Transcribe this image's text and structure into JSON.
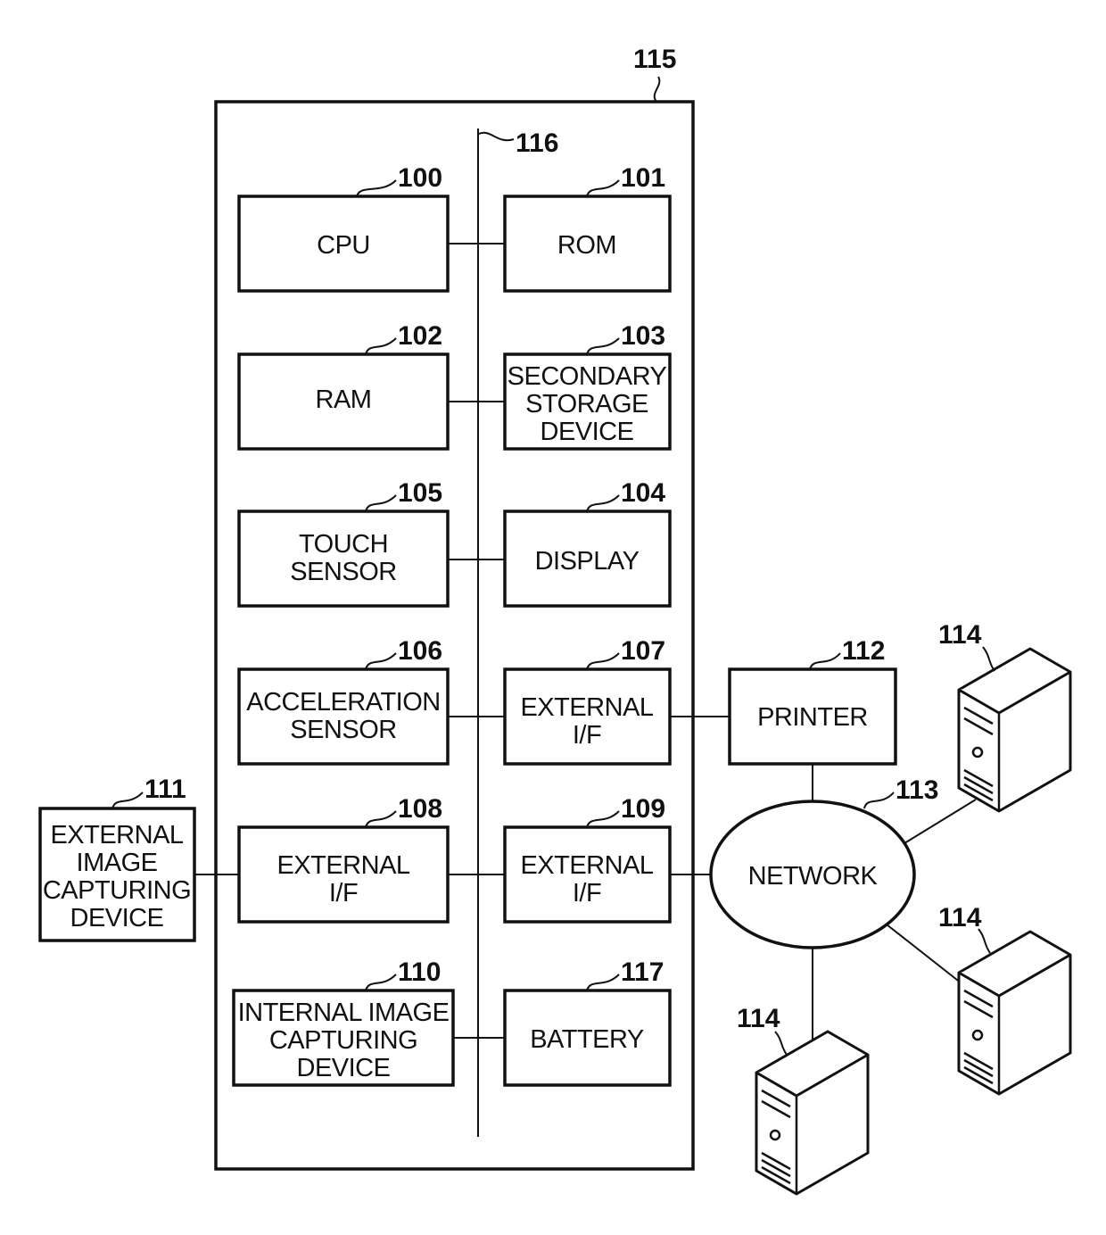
{
  "diagram": {
    "device": {
      "ref": "115"
    },
    "bus": {
      "ref": "116"
    },
    "components": {
      "cpu": {
        "ref": "100",
        "lines": [
          "CPU"
        ]
      },
      "rom": {
        "ref": "101",
        "lines": [
          "ROM"
        ]
      },
      "ram": {
        "ref": "102",
        "lines": [
          "RAM"
        ]
      },
      "secondary_storage": {
        "ref": "103",
        "lines": [
          "SECONDARY",
          "STORAGE",
          "DEVICE"
        ]
      },
      "touch_sensor": {
        "ref": "105",
        "lines": [
          "TOUCH",
          "SENSOR"
        ]
      },
      "display": {
        "ref": "104",
        "lines": [
          "DISPLAY"
        ]
      },
      "acceleration_sensor": {
        "ref": "106",
        "lines": [
          "ACCELERATION",
          "SENSOR"
        ]
      },
      "external_if_107": {
        "ref": "107",
        "lines": [
          "EXTERNAL",
          "I/F"
        ]
      },
      "external_if_108": {
        "ref": "108",
        "lines": [
          "EXTERNAL",
          "I/F"
        ]
      },
      "external_if_109": {
        "ref": "109",
        "lines": [
          "EXTERNAL",
          "I/F"
        ]
      },
      "internal_camera": {
        "ref": "110",
        "lines": [
          "INTERNAL IMAGE",
          "CAPTURING",
          "DEVICE"
        ]
      },
      "battery": {
        "ref": "117",
        "lines": [
          "BATTERY"
        ]
      }
    },
    "external": {
      "external_camera": {
        "ref": "111",
        "lines": [
          "EXTERNAL",
          "IMAGE",
          "CAPTURING",
          "DEVICE"
        ]
      },
      "printer": {
        "ref": "112",
        "lines": [
          "PRINTER"
        ]
      },
      "network": {
        "ref": "113",
        "lines": [
          "NETWORK"
        ]
      },
      "servers": [
        {
          "ref": "114"
        },
        {
          "ref": "114"
        },
        {
          "ref": "114"
        }
      ]
    }
  }
}
